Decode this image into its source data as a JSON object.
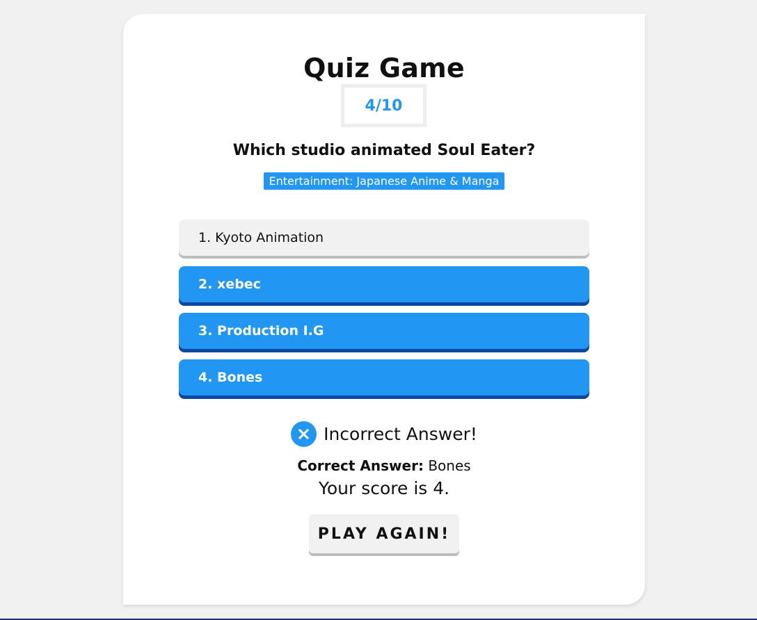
{
  "quiz": {
    "title": "Quiz Game",
    "progress": "4/10",
    "question": "Which studio animated Soul Eater?",
    "category": "Entertainment: Japanese Anime & Manga"
  },
  "answers": [
    {
      "label": "1. Kyoto Animation",
      "state": "selected"
    },
    {
      "label": "2. xebec",
      "state": "normal"
    },
    {
      "label": "3. Production I.G",
      "state": "normal"
    },
    {
      "label": "4. Bones",
      "state": "normal"
    }
  ],
  "result": {
    "icon": "close-icon",
    "message": "Incorrect Answer!",
    "correct_label": "Correct Answer:",
    "correct_value": "Bones",
    "score_text": "Your score is 4."
  },
  "actions": {
    "play_again_label": "PLAY AGAIN!"
  },
  "colors": {
    "accent": "#2196f3",
    "accent_dark": "#0d47a1",
    "page_bg": "#f1f1f1",
    "card_bg": "#ffffff"
  }
}
